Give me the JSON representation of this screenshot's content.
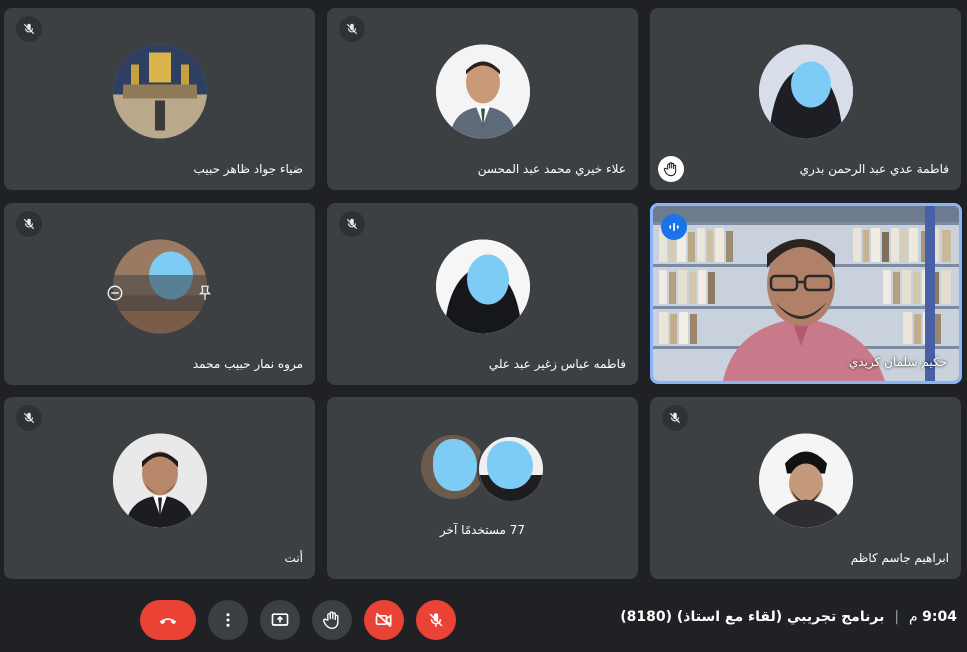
{
  "participants": [
    {
      "name": "ضياء جواد ظاهر حبيب",
      "muted": true
    },
    {
      "name": "علاء خيري محمد عبد المحسن",
      "muted": true
    },
    {
      "name": "فاطمة عدي عبد الرحمن بدري",
      "muted": false,
      "hand_raised": true
    },
    {
      "name": "مروه نمار حبيب محمد",
      "muted": true
    },
    {
      "name": "فاطمه عباس زغير عبد علي",
      "muted": true
    },
    {
      "name": "حكيم سلمان كريدي",
      "muted": false,
      "speaking": true
    },
    {
      "name": "أنت",
      "muted": true
    },
    {
      "name": "77 مستخدمًا آخر",
      "muted": false
    },
    {
      "name": "ابراهيم جاسم كاظم",
      "muted": true
    }
  ],
  "meeting": {
    "time": "9:04",
    "ampm": "م",
    "separator": "|",
    "title": "برنامج تجريبي (لقاء مع استاذ) (8180)"
  },
  "controls": [
    "hang-up",
    "more-options",
    "present",
    "raise-hand",
    "camera-off",
    "mic-off"
  ],
  "colors": {
    "background": "#202124",
    "tile": "#3c4043",
    "red": "#ea4335",
    "speaking": "#8ab4f8",
    "blur": "#7dccf5"
  }
}
